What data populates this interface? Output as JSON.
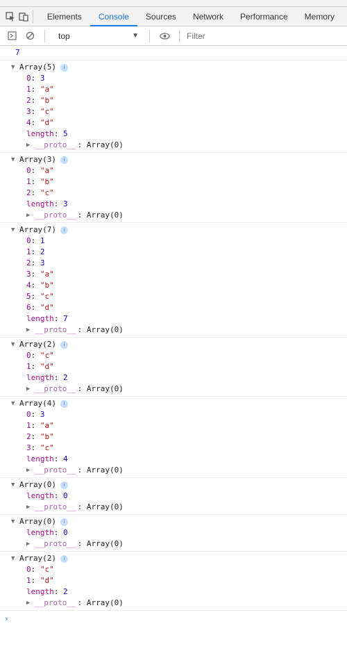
{
  "tabs": {
    "elements": "Elements",
    "console": "Console",
    "sources": "Sources",
    "network": "Network",
    "performance": "Performance",
    "memory": "Memory"
  },
  "subbar": {
    "context": "top",
    "filter_placeholder": "Filter"
  },
  "first_log": "7",
  "arrays": [
    {
      "label": "Array(5)",
      "items": [
        {
          "k": "0",
          "vtype": "num",
          "v": "3"
        },
        {
          "k": "1",
          "vtype": "str",
          "v": "\"a\""
        },
        {
          "k": "2",
          "vtype": "str",
          "v": "\"b\""
        },
        {
          "k": "3",
          "vtype": "str",
          "v": "\"c\""
        },
        {
          "k": "4",
          "vtype": "str",
          "v": "\"d\""
        }
      ],
      "length": "5",
      "proto": "Array(0)"
    },
    {
      "label": "Array(3)",
      "items": [
        {
          "k": "0",
          "vtype": "str",
          "v": "\"a\""
        },
        {
          "k": "1",
          "vtype": "str",
          "v": "\"b\""
        },
        {
          "k": "2",
          "vtype": "str",
          "v": "\"c\""
        }
      ],
      "length": "3",
      "proto": "Array(0)"
    },
    {
      "label": "Array(7)",
      "items": [
        {
          "k": "0",
          "vtype": "num",
          "v": "1"
        },
        {
          "k": "1",
          "vtype": "num",
          "v": "2"
        },
        {
          "k": "2",
          "vtype": "num",
          "v": "3"
        },
        {
          "k": "3",
          "vtype": "str",
          "v": "\"a\""
        },
        {
          "k": "4",
          "vtype": "str",
          "v": "\"b\""
        },
        {
          "k": "5",
          "vtype": "str",
          "v": "\"c\""
        },
        {
          "k": "6",
          "vtype": "str",
          "v": "\"d\""
        }
      ],
      "length": "7",
      "proto": "Array(0)"
    },
    {
      "label": "Array(2)",
      "items": [
        {
          "k": "0",
          "vtype": "str",
          "v": "\"c\""
        },
        {
          "k": "1",
          "vtype": "str",
          "v": "\"d\""
        }
      ],
      "length": "2",
      "proto": "Array(0)"
    },
    {
      "label": "Array(4)",
      "items": [
        {
          "k": "0",
          "vtype": "num",
          "v": "3"
        },
        {
          "k": "1",
          "vtype": "str",
          "v": "\"a\""
        },
        {
          "k": "2",
          "vtype": "str",
          "v": "\"b\""
        },
        {
          "k": "3",
          "vtype": "str",
          "v": "\"c\""
        }
      ],
      "length": "4",
      "proto": "Array(0)"
    },
    {
      "label": "Array(0)",
      "items": [],
      "length": "0",
      "proto": "Array(0)"
    },
    {
      "label": "Array(0)",
      "items": [],
      "length": "0",
      "proto": "Array(0)"
    },
    {
      "label": "Array(2)",
      "items": [
        {
          "k": "0",
          "vtype": "str",
          "v": "\"c\""
        },
        {
          "k": "1",
          "vtype": "str",
          "v": "\"d\""
        }
      ],
      "length": "2",
      "proto": "Array(0)"
    }
  ],
  "labels": {
    "length": "length",
    "proto": "__proto__",
    "prompt": "›"
  }
}
